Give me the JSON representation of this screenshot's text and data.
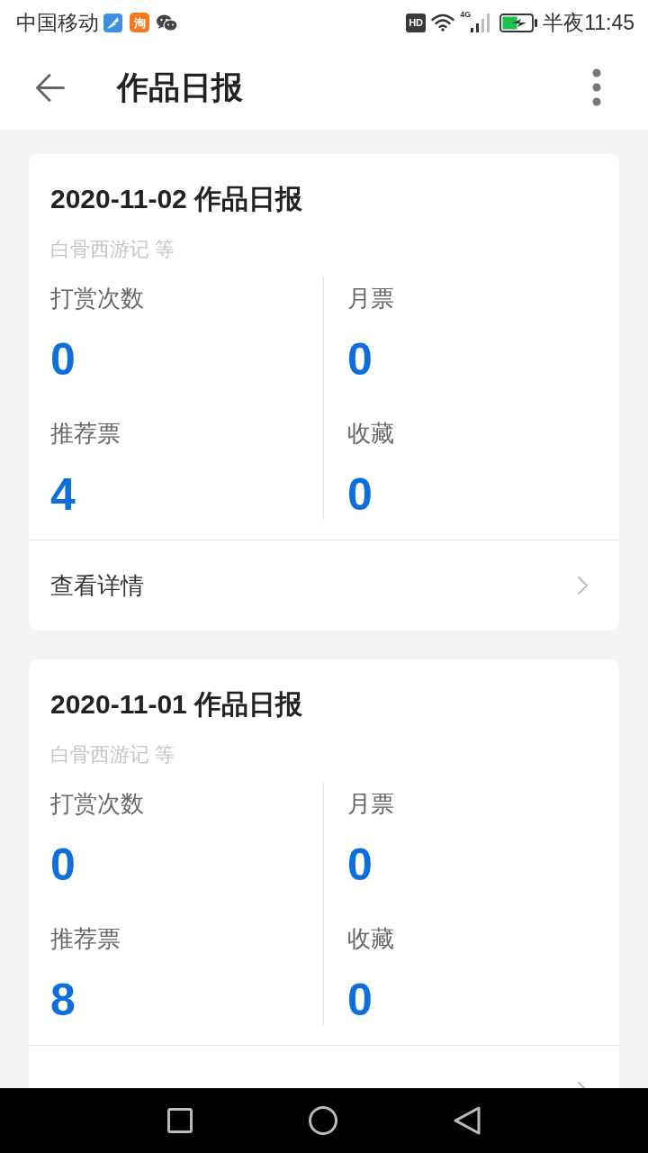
{
  "status_bar": {
    "carrier": "中国移动",
    "app_badge": "淘",
    "hd_badge": "HD",
    "network_type": "4G",
    "time": "半夜11:45"
  },
  "header": {
    "title": "作品日报"
  },
  "reports": [
    {
      "title": "2020-11-02 作品日报",
      "works": "白骨西游记 等",
      "stats": [
        {
          "label": "打赏次数",
          "value": "0"
        },
        {
          "label": "月票",
          "value": "0"
        },
        {
          "label": "推荐票",
          "value": "4"
        },
        {
          "label": "收藏",
          "value": "0"
        }
      ],
      "link": "查看详情"
    },
    {
      "title": "2020-11-01 作品日报",
      "works": "白骨西游记 等",
      "stats": [
        {
          "label": "打赏次数",
          "value": "0"
        },
        {
          "label": "月票",
          "value": "0"
        },
        {
          "label": "推荐票",
          "value": "8"
        },
        {
          "label": "收藏",
          "value": "0"
        }
      ]
    }
  ]
}
